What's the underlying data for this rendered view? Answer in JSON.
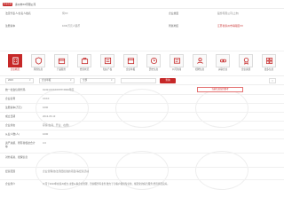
{
  "header": {
    "badge": "企业信息",
    "title": "泰州市XX有限公司"
  },
  "info": {
    "legal_rep_label": "法定代表人/负责人姓名",
    "legal_rep_value": "何XX",
    "type_label": "企业类型",
    "type_value": "股份有限公司(上市)",
    "reg_label": "注册资本",
    "reg_value": "1000万元人民币",
    "addr_label": "所属地区",
    "addr_value": "江苏省泰州市海陵区XX"
  },
  "tabs": [
    {
      "label": "企业概况",
      "icon": "building-icon"
    },
    {
      "label": "风险信息",
      "icon": "shield-icon"
    },
    {
      "label": "产品服务",
      "icon": "box-icon"
    },
    {
      "label": "经营状况",
      "icon": "briefcase-icon"
    },
    {
      "label": "知识产权",
      "icon": "certificate-icon"
    },
    {
      "label": "企业年报",
      "icon": "calendar-icon"
    },
    {
      "label": "历史信息",
      "icon": "clock-icon"
    },
    {
      "label": "公司新闻",
      "icon": "news-icon"
    },
    {
      "label": "招聘信息",
      "icon": "users-icon"
    },
    {
      "label": "关联企业",
      "icon": "link-icon"
    },
    {
      "label": "企业资质",
      "icon": "award-icon"
    },
    {
      "label": "更多信息",
      "icon": "grid-icon"
    }
  ],
  "filters": {
    "year_value": "2023",
    "category_value": "企业年报",
    "region_value": "全部",
    "search_label": "查询"
  },
  "details": {
    "r1_label": "统一社会信用代码",
    "r1_value": "91321XXXXXXXX  2023年度",
    "r1_warn": "当前信息仅供参考",
    "r2_label": "企业名称",
    "r2_value": "XXXX",
    "r3_label": "注册资本(万元)",
    "r3_value": "1000",
    "r4_label": "成立日期",
    "r4_value": "2013-05-13",
    "r5_label": "企业状态",
    "r5_value": "存续(在营、开业、在册)",
    "r6_label": "从业人数(人)",
    "r6_value": "1000",
    "r7_label": "资产总额、所有者权益合计等",
    "r7_value": "3.0",
    "r8_label": "对外投资、担保信息",
    "r8_value": "",
    "r9_label": "经营范围",
    "r9_value": "企业管理(依法须经批准的项目)等经营活动",
    "r10_label": "企业简介",
    "r10_value": "公司于2013年在泰州成立,主要从事企业管理、咨询服务等业务,致力于为客户提供专业化、规范化的综合服务,经营状况良好。"
  }
}
